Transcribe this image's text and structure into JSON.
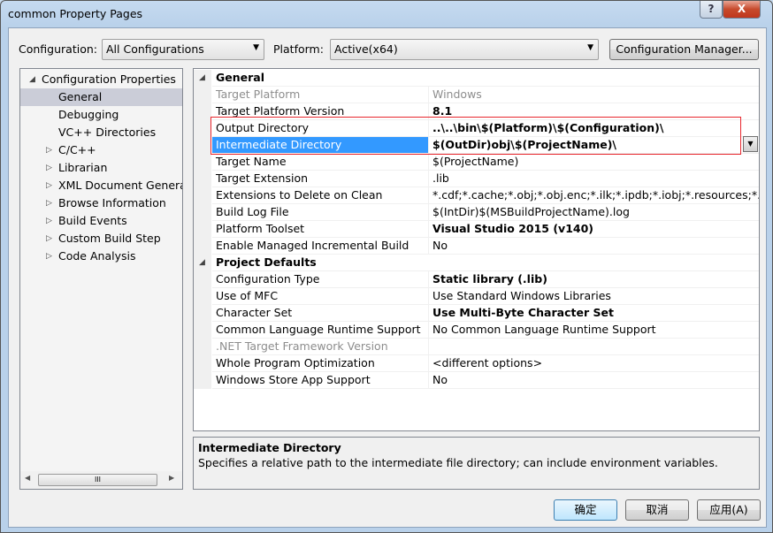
{
  "window": {
    "title": "common Property Pages",
    "help_label": "?",
    "close_label": "X"
  },
  "toolbar": {
    "configuration_label": "Configuration:",
    "configuration_value": "All Configurations",
    "platform_label": "Platform:",
    "platform_value": "Active(x64)",
    "config_manager_label": "Configuration Manager..."
  },
  "tree": {
    "items": [
      {
        "label": "Configuration Properties",
        "expander": "expanded",
        "level": 0
      },
      {
        "label": "General",
        "level": 1,
        "selected": true
      },
      {
        "label": "Debugging",
        "level": 1
      },
      {
        "label": "VC++ Directories",
        "level": 1
      },
      {
        "label": "C/C++",
        "level": 1,
        "expander": "collapsed"
      },
      {
        "label": "Librarian",
        "level": 1,
        "expander": "collapsed"
      },
      {
        "label": "XML Document Generat",
        "level": 1,
        "expander": "collapsed"
      },
      {
        "label": "Browse Information",
        "level": 1,
        "expander": "collapsed"
      },
      {
        "label": "Build Events",
        "level": 1,
        "expander": "collapsed"
      },
      {
        "label": "Custom Build Step",
        "level": 1,
        "expander": "collapsed"
      },
      {
        "label": "Code Analysis",
        "level": 1,
        "expander": "collapsed"
      }
    ],
    "scroll_thumb": "III"
  },
  "grid": {
    "rows": [
      {
        "type": "header",
        "name": "General"
      },
      {
        "name": "Target Platform",
        "value": "Windows",
        "style": "gray"
      },
      {
        "name": "Target Platform Version",
        "value": "8.1",
        "style": "bold"
      },
      {
        "name": "Output Directory",
        "value": "..\\..\\bin\\$(Platform)\\$(Configuration)\\",
        "style": "bold",
        "highlight": true
      },
      {
        "name": "Intermediate Directory",
        "value": "$(OutDir)obj\\$(ProjectName)\\",
        "style": "bold",
        "selected": true,
        "highlight": true
      },
      {
        "name": "Target Name",
        "value": "$(ProjectName)"
      },
      {
        "name": "Target Extension",
        "value": ".lib"
      },
      {
        "name": "Extensions to Delete on Clean",
        "value": "*.cdf;*.cache;*.obj;*.obj.enc;*.ilk;*.ipdb;*.iobj;*.resources;*.tlb;*.tli;*"
      },
      {
        "name": "Build Log File",
        "value": "$(IntDir)$(MSBuildProjectName).log"
      },
      {
        "name": "Platform Toolset",
        "value": "Visual Studio 2015 (v140)",
        "style": "bold"
      },
      {
        "name": "Enable Managed Incremental Build",
        "value": "No"
      },
      {
        "type": "header",
        "name": "Project Defaults"
      },
      {
        "name": "Configuration Type",
        "value": "Static library (.lib)",
        "style": "bold"
      },
      {
        "name": "Use of MFC",
        "value": "Use Standard Windows Libraries"
      },
      {
        "name": "Character Set",
        "value": "Use Multi-Byte Character Set",
        "style": "bold"
      },
      {
        "name": "Common Language Runtime Support",
        "value": "No Common Language Runtime Support"
      },
      {
        "name": ".NET Target Framework Version",
        "value": "",
        "style": "gray"
      },
      {
        "name": "Whole Program Optimization",
        "value": "<different options>"
      },
      {
        "name": "Windows Store App Support",
        "value": "No"
      }
    ],
    "highlight_color": "#e8262d",
    "selection_color": "#3399ff"
  },
  "description": {
    "title": "Intermediate Directory",
    "text": "Specifies a relative path to the intermediate file directory; can include environment variables."
  },
  "buttons": {
    "ok": "确定",
    "cancel": "取消",
    "apply": "应用(A)"
  }
}
